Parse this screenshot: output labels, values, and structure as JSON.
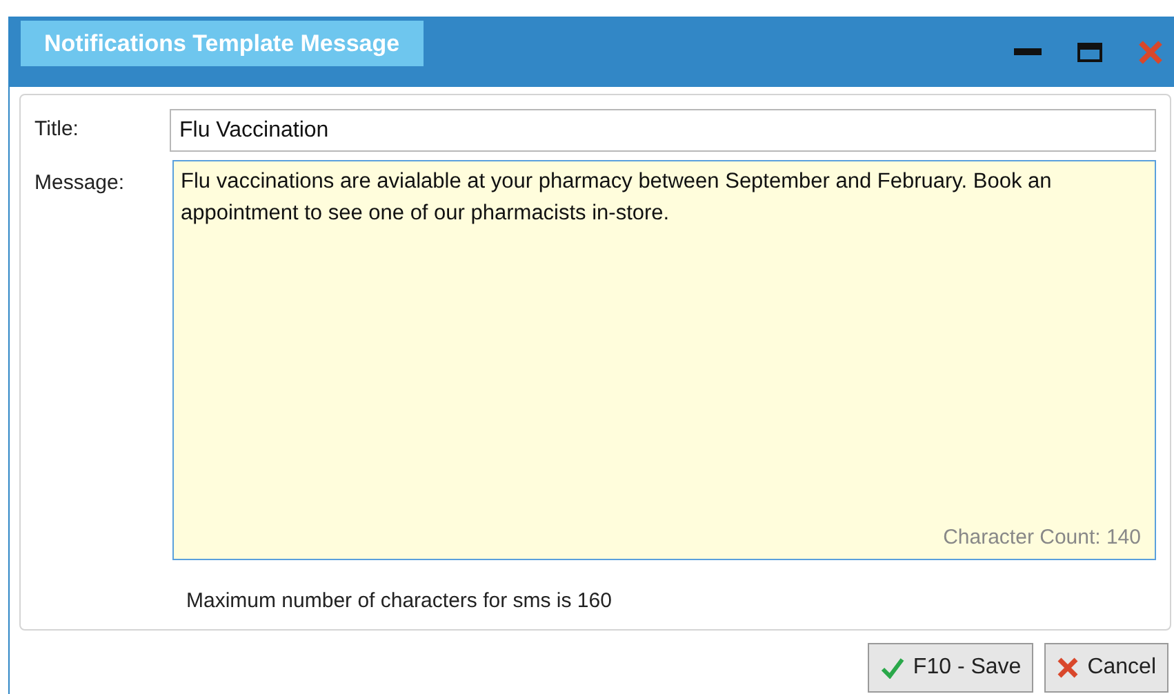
{
  "window": {
    "title": "Notifications Template Message"
  },
  "form": {
    "title_label": "Title:",
    "title_value": "Flu Vaccination",
    "message_label": "Message:",
    "message_value": "Flu vaccinations are avialable at your pharmacy between September and February. Book an appointment to see one of our pharmacists in-store.",
    "character_count": "Character Count: 140",
    "note": "Maximum number of characters for sms is 160"
  },
  "buttons": [
    {
      "label": "F10 - Save",
      "kind": "save"
    },
    {
      "label": "Cancel",
      "kind": "cancel"
    }
  ]
}
